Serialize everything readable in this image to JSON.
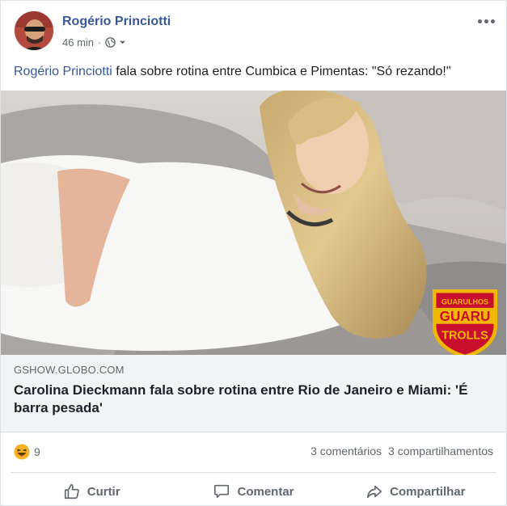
{
  "post": {
    "author": "Rogério Princiotti",
    "time": "46 min",
    "dot": "·",
    "privacy_icon": "globe-icon",
    "text_mention": "Rogério Princiotti",
    "text_rest": " fala sobre rotina entre Cumbica e Pimentas: \"Só rezando!\""
  },
  "link": {
    "domain": "GSHOW.GLOBO.COM",
    "headline": "Carolina Dieckmann fala sobre rotina entre Rio de Janeiro e Miami: 'É barra pesada'",
    "watermark": [
      "GUARULHOS",
      "GUARU",
      "TROLLS"
    ]
  },
  "stats": {
    "reaction_icon": "haha-emoji-icon",
    "reaction_count": "9",
    "comments": "3 comentários",
    "shares": "3 compartilhamentos"
  },
  "actions": [
    {
      "label": "Curtir",
      "icon": "thumbs-up-icon"
    },
    {
      "label": "Comentar",
      "icon": "comment-icon"
    },
    {
      "label": "Compartilhar",
      "icon": "share-icon"
    }
  ],
  "colors": {
    "link_blue": "#385898",
    "watermark_red": "#c8102e",
    "watermark_gold": "#f2b705"
  }
}
